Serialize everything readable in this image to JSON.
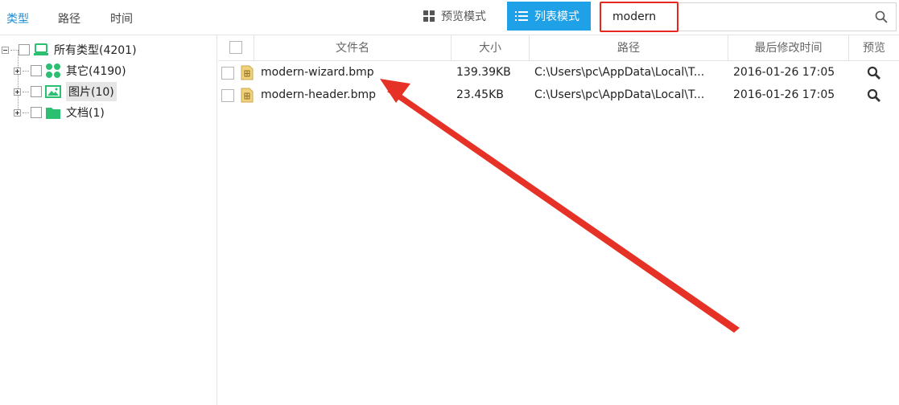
{
  "category_tabs": [
    "类型",
    "路径",
    "时间"
  ],
  "view_modes": {
    "preview": "预览模式",
    "list": "列表模式"
  },
  "search": {
    "value": "modern"
  },
  "tree": [
    {
      "label": "所有类型(4201)"
    },
    {
      "label": "其它(4190)"
    },
    {
      "label": "图片(10)"
    },
    {
      "label": "文档(1)"
    }
  ],
  "columns": [
    "文件名",
    "大小",
    "路径",
    "最后修改时间",
    "预览"
  ],
  "rows": [
    {
      "name": "modern-wizard.bmp",
      "size": "139.39KB",
      "path": "C:\\Users\\pc\\AppData\\Local\\T...",
      "date": "2016-01-26  17:05"
    },
    {
      "name": "modern-header.bmp",
      "size": "23.45KB",
      "path": "C:\\Users\\pc\\AppData\\Local\\T...",
      "date": "2016-01-26  17:05"
    }
  ],
  "colors": {
    "accent": "#1ea1e6",
    "tab_active": "#1a8fd6",
    "highlight": "#e4281f",
    "tree_icon": "#2bbf72",
    "file_icon": "#f1d27c"
  },
  "icons": [
    "grid-icon",
    "list-icon",
    "search-icon",
    "computer-icon",
    "other-icon",
    "image-icon",
    "folder-icon",
    "file-icon",
    "magnifier-icon"
  ]
}
